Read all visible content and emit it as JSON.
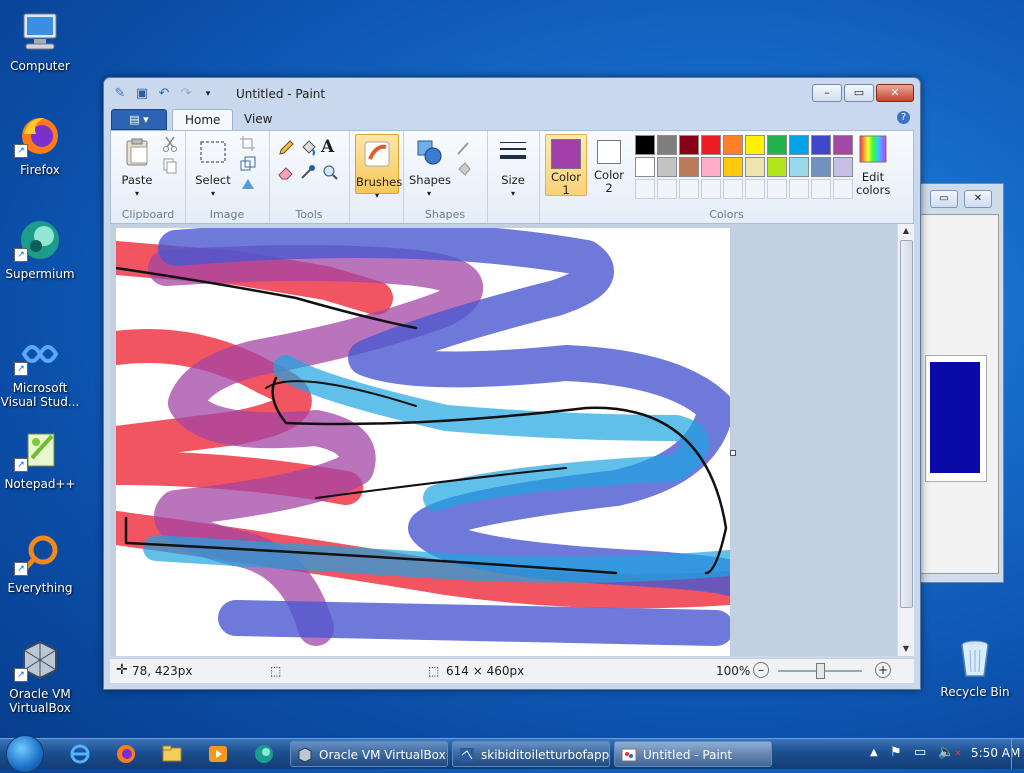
{
  "desktop": {
    "icons": [
      {
        "label": "Computer"
      },
      {
        "label": "Firefox"
      },
      {
        "label": "Supermium"
      },
      {
        "label": "Microsoft Visual Stud..."
      },
      {
        "label": "Notepad++"
      },
      {
        "label": "Everything"
      },
      {
        "label": "Oracle VM VirtualBox"
      },
      {
        "label": "Recycle Bin"
      }
    ]
  },
  "window": {
    "title": "Untitled - Paint",
    "file_button": "▤ ▾",
    "tabs": [
      "Home",
      "View"
    ],
    "help": "?"
  },
  "ribbon": {
    "clipboard": {
      "label": "Clipboard",
      "paste": "Paste"
    },
    "image": {
      "label": "Image",
      "select": "Select"
    },
    "tools": {
      "label": "Tools"
    },
    "brushes": {
      "label": "Brushes"
    },
    "shapes": {
      "label": "Shapes",
      "shapes_btn": "Shapes"
    },
    "size": {
      "label": "Size"
    },
    "colors": {
      "label": "Colors",
      "color1": "Color 1",
      "color2": "Color 2",
      "edit": "Edit colors",
      "color1_value": "#a040a8",
      "color2_value": "#ffffff",
      "palette_row1": [
        "#000000",
        "#7f7f7f",
        "#880015",
        "#ed1c24",
        "#ff7f27",
        "#fff200",
        "#22b14c",
        "#00a2e8",
        "#3f48cc",
        "#a349a4"
      ],
      "palette_row2": [
        "#ffffff",
        "#c3c3c3",
        "#b97a57",
        "#ffaec9",
        "#ffc90e",
        "#efe4b0",
        "#b5e61d",
        "#99d9ea",
        "#7092be",
        "#c8bfe7"
      ]
    }
  },
  "status": {
    "position": "78, 423px",
    "image_size": "614 × 460px",
    "zoom": "100%"
  },
  "taskbar": {
    "tasks": [
      "Oracle VM VirtualBox...",
      "skibiditoiletturbofapp...",
      "Untitled - Paint"
    ],
    "time": "5:50 AM"
  }
}
